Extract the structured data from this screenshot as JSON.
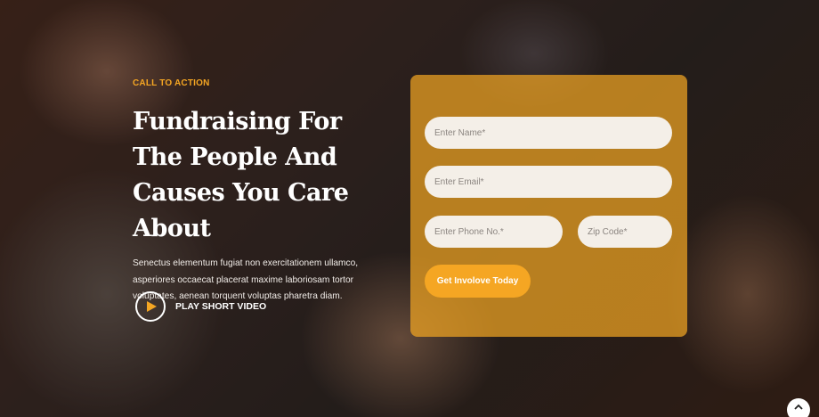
{
  "hero": {
    "eyebrow": "CALL TO ACTION",
    "headline": "Fundraising For The People And Causes You Care About",
    "lead": "Senectus elementum fugiat non exercitationem ullamco, asperiores occaecat placerat maxime laboriosam tortor voluptates, aenean torquent voluptas pharetra diam.",
    "play_label": "PLAY SHORT VIDEO",
    "play_icon": "play-icon"
  },
  "form": {
    "name_placeholder": "Enter Name*",
    "email_placeholder": "Enter Email*",
    "phone_placeholder": "Enter Phone No.*",
    "zip_placeholder": "Zip Code*",
    "submit_label": "Get Involove Today"
  },
  "scroll_top_icon": "chevron-up-icon",
  "colors": {
    "accent": "#f5a623",
    "card": "rgba(241,165,35,0.72)"
  }
}
